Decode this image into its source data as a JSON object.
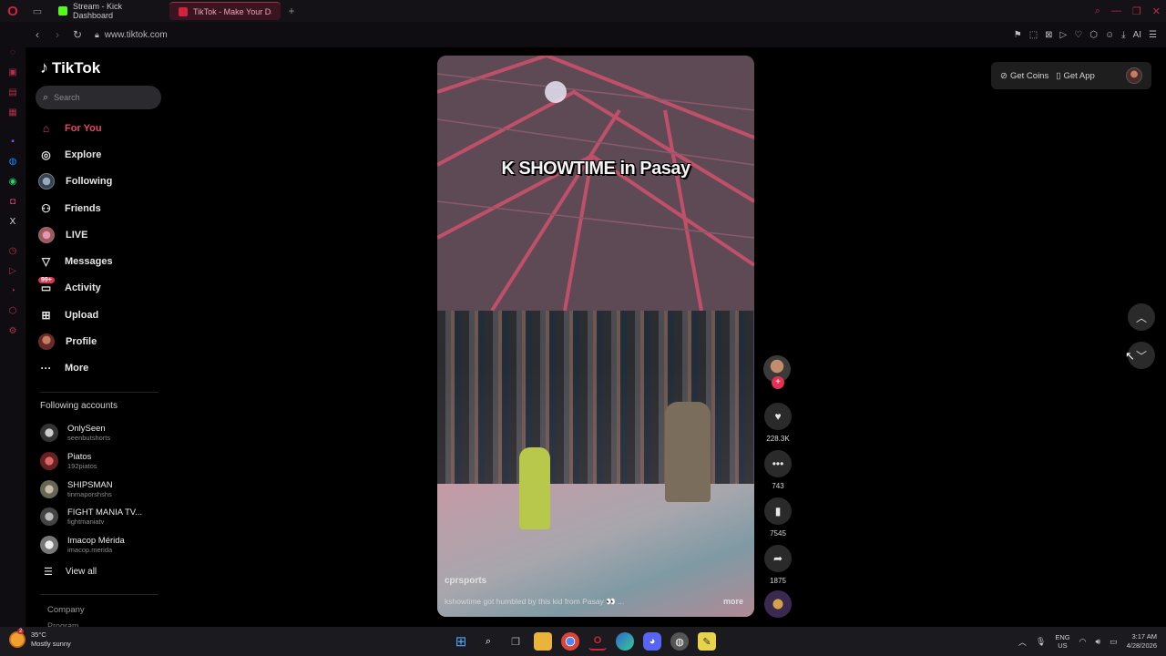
{
  "browser": {
    "tabs": [
      {
        "label": "Stream - Kick Dashboard",
        "favicon_color": "#53fc18"
      },
      {
        "label": "TikTok - Make Your Da",
        "favicon_color": "#d0233c"
      }
    ],
    "url": "www.tiktok.com",
    "ai_label": "AI"
  },
  "sidebar": {
    "logo": "TikTok",
    "search_placeholder": "Search",
    "nav": [
      {
        "label": "For You",
        "icon": "home-icon",
        "active": true
      },
      {
        "label": "Explore",
        "icon": "compass-icon"
      },
      {
        "label": "Following",
        "icon": "following-avatar"
      },
      {
        "label": "Friends",
        "icon": "friends-icon"
      },
      {
        "label": "LIVE",
        "icon": "live-avatar"
      },
      {
        "label": "Messages",
        "icon": "send-icon"
      },
      {
        "label": "Activity",
        "icon": "inbox-icon",
        "badge": "99+"
      },
      {
        "label": "Upload",
        "icon": "plus-square-icon"
      },
      {
        "label": "Profile",
        "icon": "profile-avatar"
      },
      {
        "label": "More",
        "icon": "ellipsis-icon"
      }
    ],
    "following_title": "Following accounts",
    "accounts": [
      {
        "name": "OnlySeen",
        "handle": "seenbutshorts"
      },
      {
        "name": "Piatos",
        "handle": "192piatos"
      },
      {
        "name": "SHIPSMAN",
        "handle": "tinmaporshshs"
      },
      {
        "name": "FIGHT MANIA TV...",
        "handle": "fightmaniatv"
      },
      {
        "name": "Imacop Mérida",
        "handle": "imacop.merida"
      }
    ],
    "view_all": "View all",
    "company": "Company",
    "program": "Program"
  },
  "video": {
    "overlay_title": "K SHOWTIME in Pasay",
    "username": "cprsports",
    "caption": "kshowtime got humbled by this kid from Pasay 👀 ...",
    "more": "more",
    "likes": "228.3K",
    "comments": "743",
    "saves": "7545",
    "shares": "1875"
  },
  "top_right": {
    "get_coins": "Get Coins",
    "get_app": "Get App"
  },
  "taskbar": {
    "temperature": "35°C",
    "weather": "Mostly sunny",
    "weather_badge": "2",
    "lang_top": "ENG",
    "lang_bottom": "US",
    "time": "3:17 AM",
    "date": "4/28/2026"
  }
}
